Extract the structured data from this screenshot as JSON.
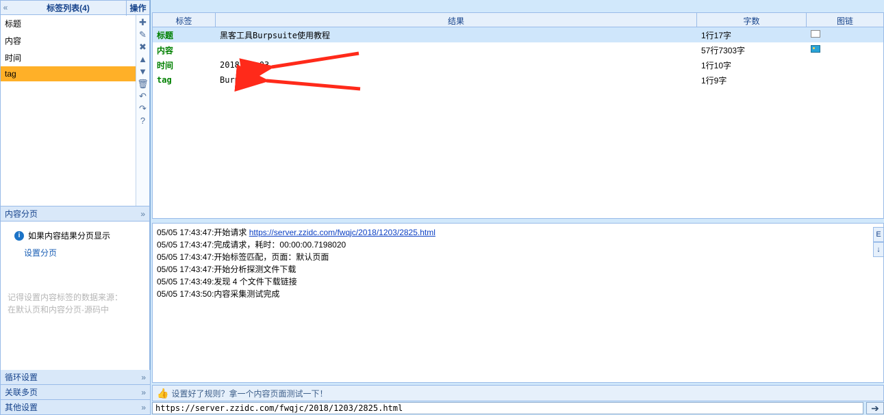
{
  "left": {
    "tags_header": "标签列表(4)",
    "ops_header": "操作",
    "tag_items": [
      "标题",
      "内容",
      "时间",
      "tag"
    ],
    "ops_icons": [
      "plus",
      "pencil",
      "x",
      "up",
      "down",
      "trash",
      "undo",
      "redo",
      "question"
    ],
    "content_page_header": "内容分页",
    "content_page_text": "如果内容结果分页显示",
    "content_page_link": "设置分页",
    "content_page_hint1": "记得设置内容标签的数据来源：",
    "content_page_hint2": "在默认页和内容分页-源码中",
    "loop_header": "循环设置",
    "relate_header": "关联多页",
    "other_header": "其他设置"
  },
  "results": {
    "headers": {
      "label": "标签",
      "result": "结果",
      "count": "字数",
      "chain": "图链"
    },
    "rows": [
      {
        "label": "标题",
        "result": "黑客工具Burpsuite使用教程",
        "count": "1行17字",
        "chain": "blank"
      },
      {
        "label": "内容",
        "result": "",
        "count": "57行7303字",
        "chain": "image"
      },
      {
        "label": "时间",
        "result": "2018-12-03",
        "count": "1行10字",
        "chain": ""
      },
      {
        "label": "tag",
        "result": "Burpsuite",
        "count": "1行9字",
        "chain": ""
      }
    ]
  },
  "log": {
    "l1a": "05/05 17:43:47:开始请求 ",
    "l1b": "https://server.zzidc.com/fwqjc/2018/1203/2825.html",
    "l2": "05/05 17:43:47:完成请求，耗时：00:00:00.7198020",
    "l3": "05/05 17:43:47:开始标签匹配，页面：默认页面",
    "l4": "05/05 17:43:47:开始分析探测文件下载",
    "l5": "05/05 17:43:49:发现 4 个文件下载链接",
    "l6": "05/05 17:43:50:内容采集测试完成"
  },
  "side": {
    "e": "E",
    "down": "↓"
  },
  "footer": "设置好了规则？拿一个内容页面测试一下！",
  "url": "https://server.zzidc.com/fwqjc/2018/1203/2825.html"
}
